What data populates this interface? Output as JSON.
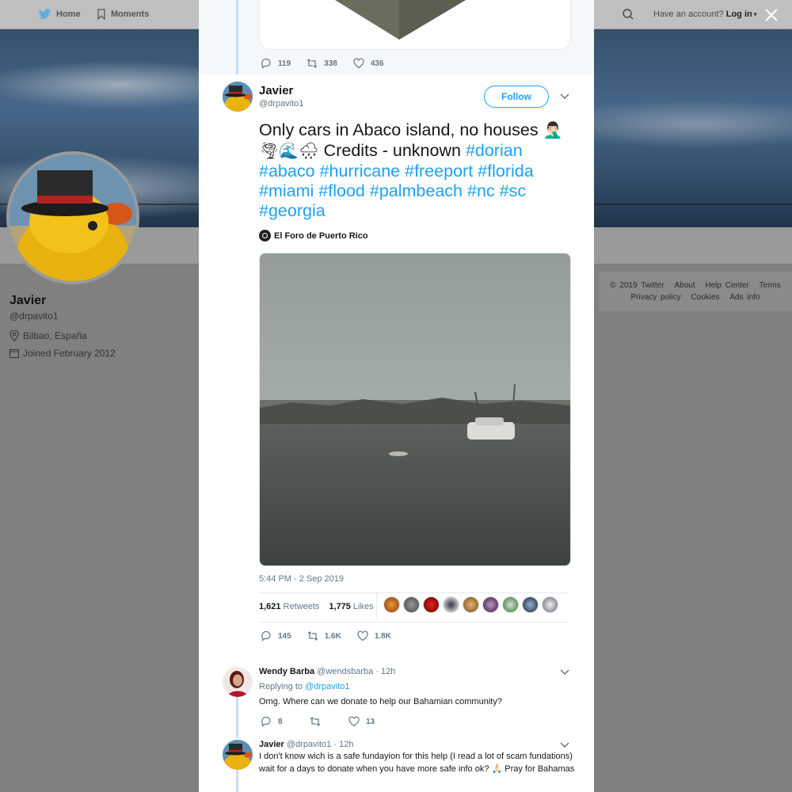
{
  "nav": {
    "home": "Home",
    "moments": "Moments",
    "account_prompt": "Have an account?",
    "login": "Log in"
  },
  "profile": {
    "name": "Javier",
    "handle": "@drpavito1",
    "location": "Bilbao, España",
    "joined": "Joined February 2012"
  },
  "footer": {
    "row1": [
      "© 2019 Twitter",
      "About",
      "Help Center",
      "Terms"
    ],
    "row2": [
      "Privacy policy",
      "Cookies",
      "Ads info"
    ]
  },
  "prev_tweet": {
    "replies": "119",
    "retweets": "338",
    "likes": "436"
  },
  "tweet": {
    "name": "Javier",
    "handle": "@drpavito1",
    "follow": "Follow",
    "text_plain": "Only cars in Abaco island, no houses",
    "emoji1": "🤦🏻‍♂️",
    "emoji2": "🌪🌊🌧",
    "credits": "Credits - unknown",
    "hashtags": [
      "#dorian",
      "#abaco",
      "#hurricane",
      "#freeport",
      "#florida",
      "#miami",
      "#flood",
      "#palmbeach",
      "#nc",
      "#sc",
      "#georgia"
    ],
    "source": "El Foro de Puerto Rico",
    "timestamp": "5:44 PM - 2 Sep 2019",
    "retweets_count": "1,621",
    "retweets_label": "Retweets",
    "likes_count": "1,775",
    "likes_label": "Likes",
    "replies": "145",
    "retweets_short": "1.6K",
    "likes_short": "1.8K"
  },
  "replies": [
    {
      "name": "Wendy Barba",
      "handle": "@wendsbarba",
      "time": "· 12h",
      "replying_prefix": "Replying to",
      "replying_to": "@drpavito1",
      "text": "Omg. Where can we donate to help our Bahamian community?",
      "reply_count": "8",
      "retweet_count": "",
      "like_count": "13"
    },
    {
      "name": "Javier",
      "handle": "@drpavito1",
      "time": "· 12h",
      "text": "I don't know wich is a safe fundayion for this help (I read a lot of scam fundations) wait for a days to donate when you have more safe info ok? 🙏🏻 Pray for Bahamas"
    }
  ],
  "colors": {
    "accent": "#1da1f2",
    "text": "#14171a",
    "muted": "#657786",
    "overlay": "#808080"
  }
}
